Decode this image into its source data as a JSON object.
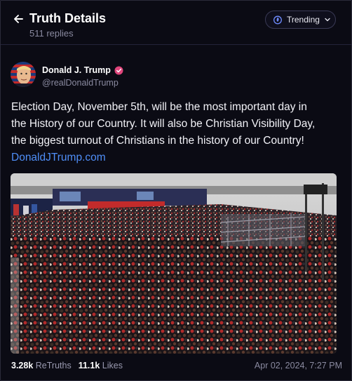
{
  "header": {
    "title": "Truth Details",
    "subtitle": "511 replies",
    "back_icon": "arrow-left-icon",
    "trending_label": "Trending",
    "trending_icon": "flame-icon",
    "dropdown_icon": "chevron-down-icon"
  },
  "post": {
    "author_name": "Donald J. Trump",
    "verified_icon": "verified-badge-icon",
    "author_handle": "@realDonaldTrump",
    "text_lines": [
      "Election Day, November 5th, will be the most important day in",
      "the History of our Country. It will also be Christian Visibility Day,",
      "the biggest turnout of Christians in the history of our Country!"
    ],
    "link": "DonaldJTrump.com",
    "media_description_icon": "rally-photo"
  },
  "stats": {
    "retruths_count": "3.28k",
    "retruths_label": "ReTruths",
    "likes_count": "11.1k",
    "likes_label": "Likes",
    "timestamp": "Apr 02, 2024, 7:27 PM"
  },
  "colors": {
    "background": "#0b0b14",
    "accent_link": "#4f8ef7",
    "verified": "#e0457b",
    "muted_text": "#8a8aa0"
  }
}
